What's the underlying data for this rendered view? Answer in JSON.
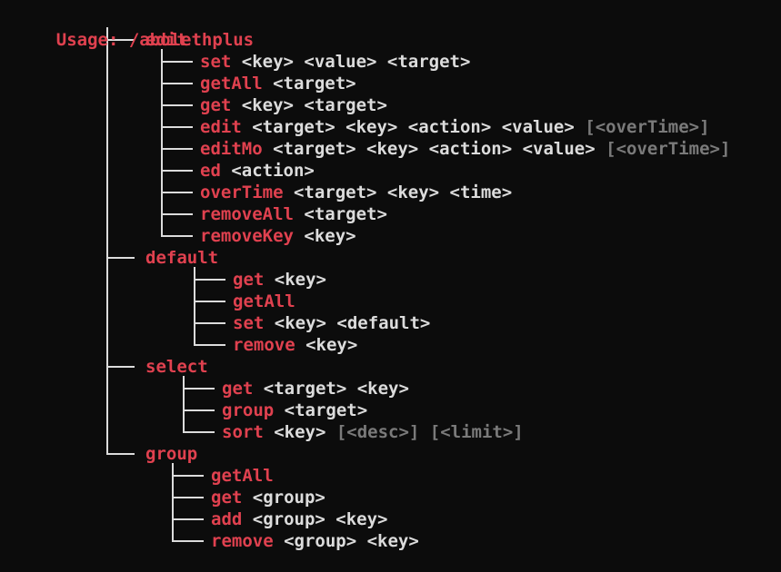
{
  "usage": {
    "prefix": "Usage: ",
    "command": "/abolethplus"
  },
  "groups": [
    {
      "name": "edit",
      "subcommands": [
        {
          "name": "set",
          "args": "<key> <value> <target>",
          "optional": ""
        },
        {
          "name": "getAll",
          "args": "<target>",
          "optional": ""
        },
        {
          "name": "get",
          "args": "<key> <target>",
          "optional": ""
        },
        {
          "name": "edit",
          "args": "<target> <key> <action> <value>",
          "optional": "[<overTime>]"
        },
        {
          "name": "editMo",
          "args": "<target> <key> <action> <value>",
          "optional": "[<overTime>]"
        },
        {
          "name": "ed",
          "args": "<action>",
          "optional": ""
        },
        {
          "name": "overTime",
          "args": "<target> <key> <time>",
          "optional": ""
        },
        {
          "name": "removeAll",
          "args": "<target>",
          "optional": ""
        },
        {
          "name": "removeKey",
          "args": "<key>",
          "optional": ""
        }
      ]
    },
    {
      "name": "default",
      "subcommands": [
        {
          "name": "get",
          "args": "<key>",
          "optional": ""
        },
        {
          "name": "getAll",
          "args": "",
          "optional": ""
        },
        {
          "name": "set",
          "args": "<key> <default>",
          "optional": ""
        },
        {
          "name": "remove",
          "args": "<key>",
          "optional": ""
        }
      ]
    },
    {
      "name": "select",
      "subcommands": [
        {
          "name": "get",
          "args": "<target> <key>",
          "optional": ""
        },
        {
          "name": "group",
          "args": "<target>",
          "optional": ""
        },
        {
          "name": "sort",
          "args": "<key>",
          "optional": "[<desc>] [<limit>]"
        }
      ]
    },
    {
      "name": "group",
      "subcommands": [
        {
          "name": "getAll",
          "args": "",
          "optional": ""
        },
        {
          "name": "get",
          "args": "<group>",
          "optional": ""
        },
        {
          "name": "add",
          "args": "<group> <key>",
          "optional": ""
        },
        {
          "name": "remove",
          "args": "<group> <key>",
          "optional": ""
        }
      ]
    }
  ],
  "colors": {
    "background": "#0c0c0c",
    "command": "#e0414f",
    "argument": "#dcdcdc",
    "optional": "#7a7a7a",
    "tree": "#dcdcdc"
  }
}
